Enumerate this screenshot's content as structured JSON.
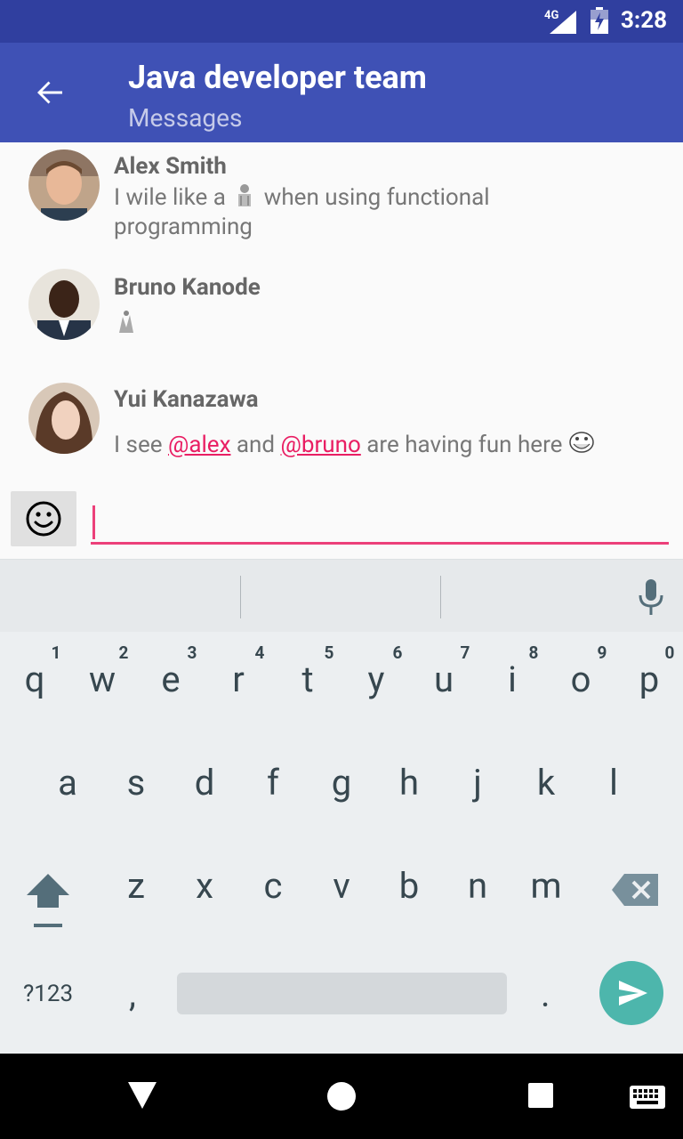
{
  "status_bar": {
    "network": "4G",
    "time": "3:28"
  },
  "app_bar": {
    "title": "Java developer team",
    "subtitle": "Messages",
    "back_icon": "arrow-back-icon"
  },
  "messages": [
    {
      "name": "Alex Smith",
      "text_line1_pre": "I wile like a ",
      "text_line1_post": " when using functional",
      "text_line2": "programming"
    },
    {
      "name": "Bruno Kanode"
    },
    {
      "name": "Yui Kanazawa",
      "text_pre": "I see ",
      "mention1": "@alex",
      "text_mid": " and ",
      "mention2": "@bruno",
      "text_post": " are having fun here "
    }
  ],
  "compose": {
    "emoji_icon": "smiley-face-icon",
    "value": "",
    "accent": "#ec407a"
  },
  "keyboard": {
    "row1": [
      "q",
      "w",
      "e",
      "r",
      "t",
      "y",
      "u",
      "i",
      "o",
      "p"
    ],
    "row1_hints": [
      "1",
      "2",
      "3",
      "4",
      "5",
      "6",
      "7",
      "8",
      "9",
      "0"
    ],
    "row2": [
      "a",
      "s",
      "d",
      "f",
      "g",
      "h",
      "j",
      "k",
      "l"
    ],
    "row3": [
      "z",
      "x",
      "c",
      "v",
      "b",
      "n",
      "m"
    ],
    "symbols_label": "?123",
    "comma": ",",
    "period": "."
  },
  "colors": {
    "primary": "#3f51b5",
    "primary_dark": "#303f9f",
    "accent": "#ec407a",
    "send": "#4db6ac"
  }
}
